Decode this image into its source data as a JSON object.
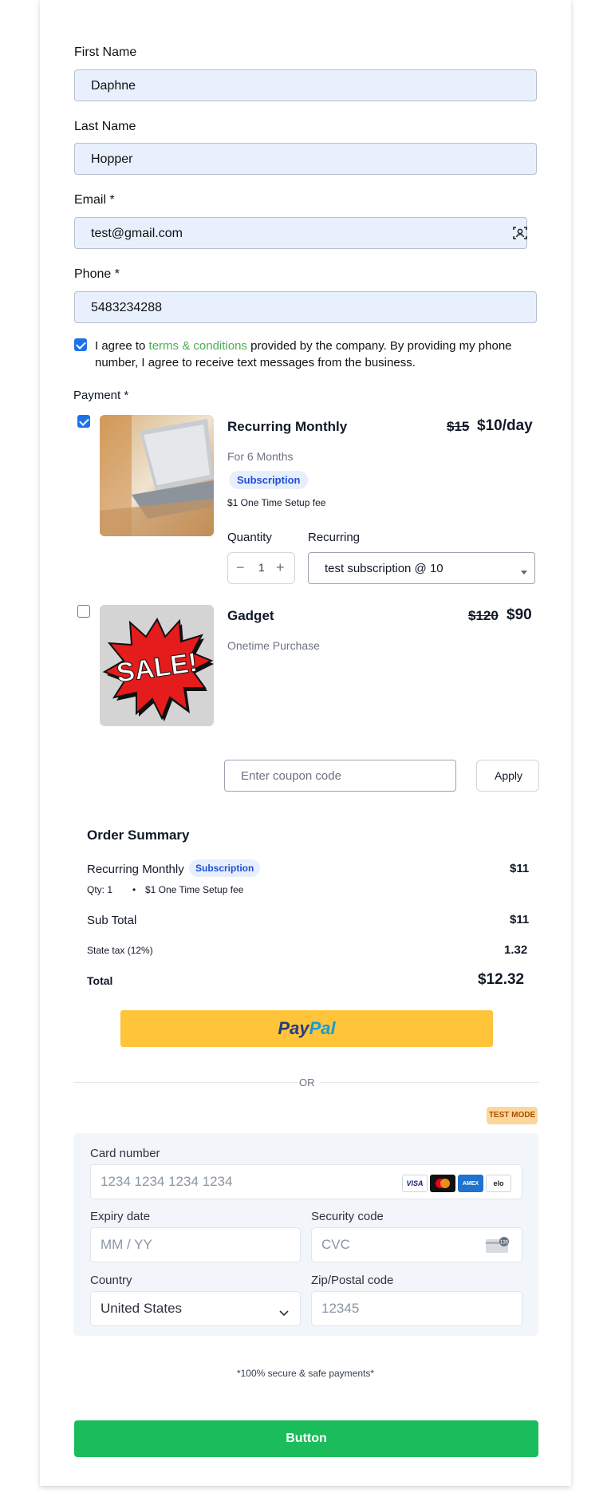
{
  "form": {
    "first_name_label": "First Name",
    "first_name_value": "Daphne",
    "last_name_label": "Last Name",
    "last_name_value": "Hopper",
    "email_label": "Email *",
    "email_value": "test@gmail.com",
    "phone_label": "Phone *",
    "phone_value": "5483234288",
    "agree_prefix": "I agree to ",
    "agree_link": "terms & conditions",
    "agree_suffix": " provided by the company. By providing my phone number, I agree to receive text messages from the business.",
    "payment_label": "Payment *"
  },
  "products": [
    {
      "name": "Recurring Monthly",
      "old_price": "$15",
      "price": "$10/day",
      "subtitle": "For 6 Months",
      "badge": "Subscription",
      "setup_fee": "$1 One Time Setup fee",
      "quantity_label": "Quantity",
      "quantity": "1",
      "recurring_label": "Recurring",
      "recurring_value": "test subscription @ 10",
      "selected": true
    },
    {
      "name": "Gadget",
      "old_price": "$120",
      "price": "$90",
      "subtitle": "Onetime Purchase",
      "image_text": "SALE!",
      "selected": false
    }
  ],
  "coupon": {
    "placeholder": "Enter coupon code",
    "apply_label": "Apply"
  },
  "summary": {
    "title": "Order Summary",
    "item_name": "Recurring Monthly",
    "item_badge": "Subscription",
    "item_price": "$11",
    "qty_text": "Qty: 1",
    "fee_text": "$1 One Time Setup fee",
    "subtotal_label": "Sub Total",
    "subtotal_value": "$11",
    "tax_label": "State tax (12%)",
    "tax_value": "1.32",
    "total_label": "Total",
    "total_value": "$12.32"
  },
  "paypal": {
    "pay_text": "Pay",
    "pal_text": "Pal"
  },
  "divider_text": "OR",
  "test_mode": "TEST MODE",
  "stripe": {
    "card_number_label": "Card number",
    "card_number_placeholder": "1234 1234 1234 1234",
    "expiry_label": "Expiry date",
    "expiry_placeholder": "MM / YY",
    "cvc_label": "Security code",
    "cvc_placeholder": "CVC",
    "country_label": "Country",
    "country_value": "United States",
    "zip_label": "Zip/Postal code",
    "zip_placeholder": "12345",
    "brands": [
      "VISA",
      "mastercard",
      "AMEX",
      "elo"
    ]
  },
  "secure_text": "*100% secure & safe payments*",
  "submit_label": "Button",
  "colors": {
    "submit": "#1abc5c",
    "paypal": "#ffc439",
    "link": "#4caf50",
    "input_bg": "#e8f0fe"
  }
}
